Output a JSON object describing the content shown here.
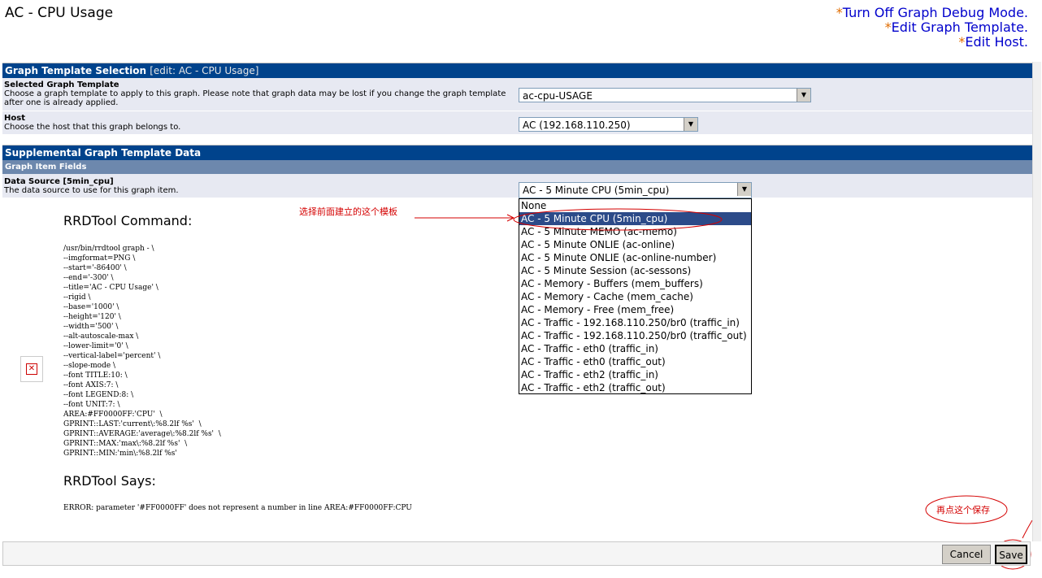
{
  "page": {
    "title": "AC - CPU Usage",
    "links": [
      {
        "star": "*",
        "label": "Turn Off Graph Debug Mode."
      },
      {
        "star": "*",
        "label": "Edit Graph Template."
      },
      {
        "star": "*",
        "label": "Edit Host."
      }
    ]
  },
  "section1": {
    "header": "Graph Template Selection",
    "header_edit": "[edit: AC - CPU Usage]",
    "template_field": {
      "title": "Selected Graph Template",
      "description": "Choose a graph template to apply to this graph. Please note that graph data may be lost if you change the graph template after one is already applied.",
      "value": "ac-cpu-USAGE"
    },
    "host_field": {
      "title": "Host",
      "description": "Choose the host that this graph belongs to.",
      "value": "AC (192.168.110.250)"
    }
  },
  "section2": {
    "header": "Supplemental Graph Template Data",
    "subheader": "Graph Item Fields",
    "datasource_field": {
      "title": "Data Source [5min_cpu]",
      "description": "The data source to use for this graph item.",
      "value": "AC - 5 Minute CPU (5min_cpu)"
    }
  },
  "dropdown": {
    "options": [
      "None",
      "AC - 5 Minute CPU (5min_cpu)",
      "AC - 5 Minute MEMO (ac-memo)",
      "AC - 5 Minute ONLIE (ac-online)",
      "AC - 5 Minute ONLIE (ac-online-number)",
      "AC - 5 Minute Session (ac-sessons)",
      "AC - Memory - Buffers (mem_buffers)",
      "AC - Memory - Cache (mem_cache)",
      "AC - Memory - Free (mem_free)",
      "AC - Traffic - 192.168.110.250/br0 (traffic_in)",
      "AC - Traffic - 192.168.110.250/br0 (traffic_out)",
      "AC - Traffic - eth0 (traffic_in)",
      "AC - Traffic - eth0 (traffic_out)",
      "AC - Traffic - eth2 (traffic_in)",
      "AC - Traffic - eth2 (traffic_out)"
    ],
    "selected_index": 1
  },
  "rrd": {
    "command_title": "RRDTool Command:",
    "command": "/usr/bin/rrdtool graph - \\\n--imgformat=PNG \\\n--start='-86400' \\\n--end='-300' \\\n--title='AC - CPU Usage' \\\n--rigid \\\n--base='1000' \\\n--height='120' \\\n--width='500' \\\n--alt-autoscale-max \\\n--lower-limit='0' \\\n--vertical-label='percent' \\\n--slope-mode \\\n--font TITLE:10: \\\n--font AXIS:7: \\\n--font LEGEND:8: \\\n--font UNIT:7: \\\nAREA:#FF0000FF:'CPU'  \\\nGPRINT::LAST:'current\\:%8.2lf %s'  \\\nGPRINT::AVERAGE:'average\\:%8.2lf %s'  \\\nGPRINT::MAX:'max\\:%8.2lf %s'  \\\nGPRINT::MIN:'min\\:%8.2lf %s'",
    "says_title": "RRDTool Says:",
    "error": "ERROR: parameter '#FF0000FF' does not represent a number in line AREA:#FF0000FF:CPU"
  },
  "annotations": {
    "select_note": "选择前面建立的这个模板",
    "save_note": "再点这个保存"
  },
  "buttons": {
    "cancel": "Cancel",
    "save": "Save"
  },
  "colors": {
    "header": "#00438c",
    "subheader": "#6d88ad",
    "row": "#e7e9f2",
    "annotation": "#d40000",
    "link": "#0000cc"
  }
}
